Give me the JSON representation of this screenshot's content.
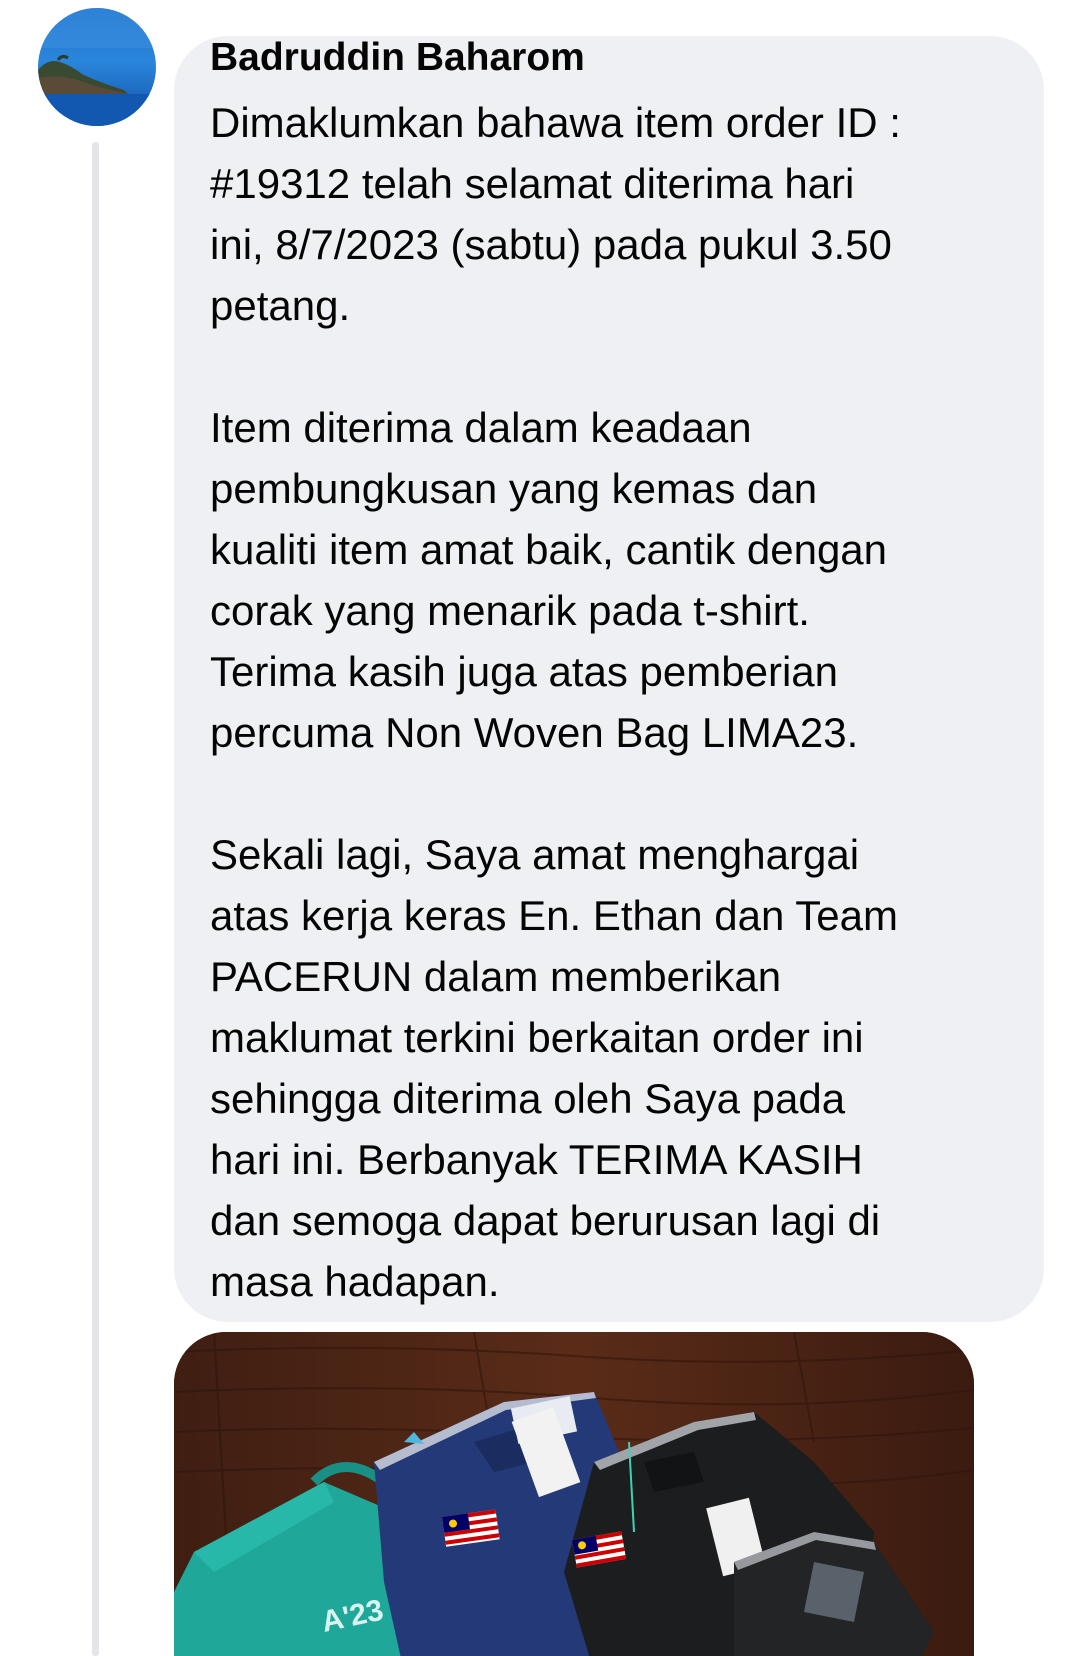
{
  "comment": {
    "author": "Badruddin Baharom",
    "paragraphs": [
      "Dimaklumkan bahawa item order ID :\n#19312 telah selamat diterima hari\nini, 8/7/2023 (sabtu) pada pukul 3.50\npetang.",
      "Item diterima dalam keadaan\npembungkusan yang kemas dan\nkualiti item amat baik, cantik dengan\ncorak yang menarik pada t-shirt.\nTerima kasih juga atas pemberian\npercuma Non Woven Bag LIMA23.",
      "Sekali lagi, Saya amat menghargai\natas kerja keras En. Ethan dan Team\nPACERUN dalam memberikan\nmaklumat terkini berkaitan order ini\nsehingga diterima oleh Saya pada\nhari ini. Berbanyak TERIMA KASIH\ndan semoga dapat berurusan lagi di\nmasa hadapan."
    ],
    "bag_print": "A'23"
  },
  "colors": {
    "bubble_background": "#eff0f3",
    "text": "#050505",
    "thread_line": "#e3e5e8",
    "bag_teal": "#1fa89a",
    "shirt_navy": "#243a78",
    "shirt_black": "#1b1d1f",
    "table_wood": "#4a2416"
  }
}
